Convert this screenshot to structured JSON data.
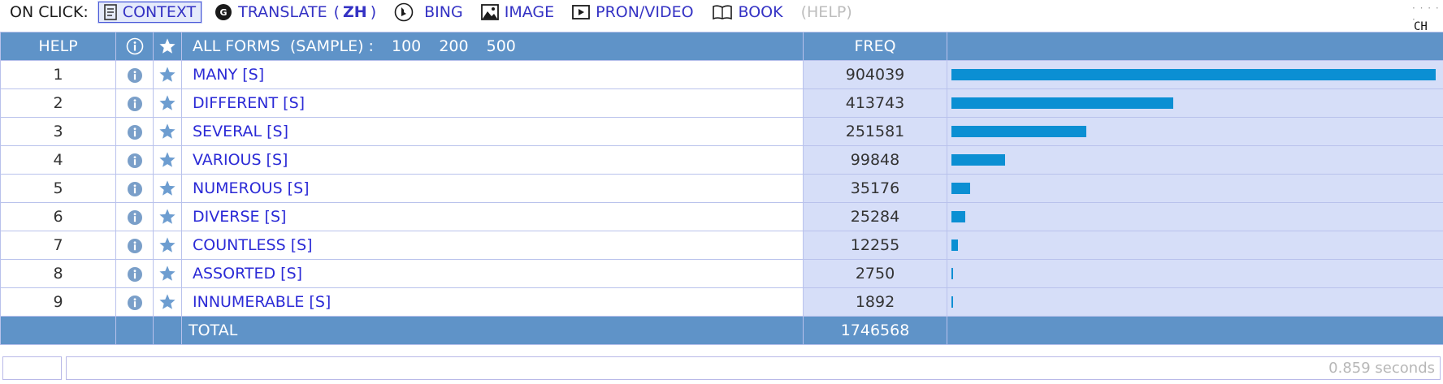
{
  "toolbar": {
    "on_click_label": "ON CLICK:",
    "items": {
      "context": "CONTEXT",
      "translate": "TRANSLATE",
      "translate_lang": "ZH",
      "bing": "BING",
      "image": "IMAGE",
      "pron_video": "PRON/VIDEO",
      "book": "BOOK",
      "help": "(HELP)"
    },
    "active": "context"
  },
  "side_widget": {
    "lang": "CH"
  },
  "table": {
    "header": {
      "help": "HELP",
      "forms_label": "ALL FORMS  (SAMPLE) :",
      "sample_sizes": [
        "100",
        "200",
        "500"
      ],
      "freq": "FREQ"
    },
    "rows": [
      {
        "num": "1",
        "form": "MANY [S]",
        "freq": "904039",
        "value": 904039
      },
      {
        "num": "2",
        "form": "DIFFERENT [S]",
        "freq": "413743",
        "value": 413743
      },
      {
        "num": "3",
        "form": "SEVERAL [S]",
        "freq": "251581",
        "value": 251581
      },
      {
        "num": "4",
        "form": "VARIOUS [S]",
        "freq": "99848",
        "value": 99848
      },
      {
        "num": "5",
        "form": "NUMEROUS [S]",
        "freq": "35176",
        "value": 35176
      },
      {
        "num": "6",
        "form": "DIVERSE [S]",
        "freq": "25284",
        "value": 25284
      },
      {
        "num": "7",
        "form": "COUNTLESS [S]",
        "freq": "12255",
        "value": 12255
      },
      {
        "num": "8",
        "form": "ASSORTED [S]",
        "freq": "2750",
        "value": 2750
      },
      {
        "num": "9",
        "form": "INNUMERABLE [S]",
        "freq": "1892",
        "value": 1892
      }
    ],
    "footer": {
      "label": "TOTAL",
      "total": "1746568"
    }
  },
  "status": {
    "time": "0.859 seconds"
  },
  "colors": {
    "bar": "#0b8fd3",
    "header": "#5f93c8",
    "freq_bg": "#d6def8",
    "link": "#2b2ad6"
  }
}
